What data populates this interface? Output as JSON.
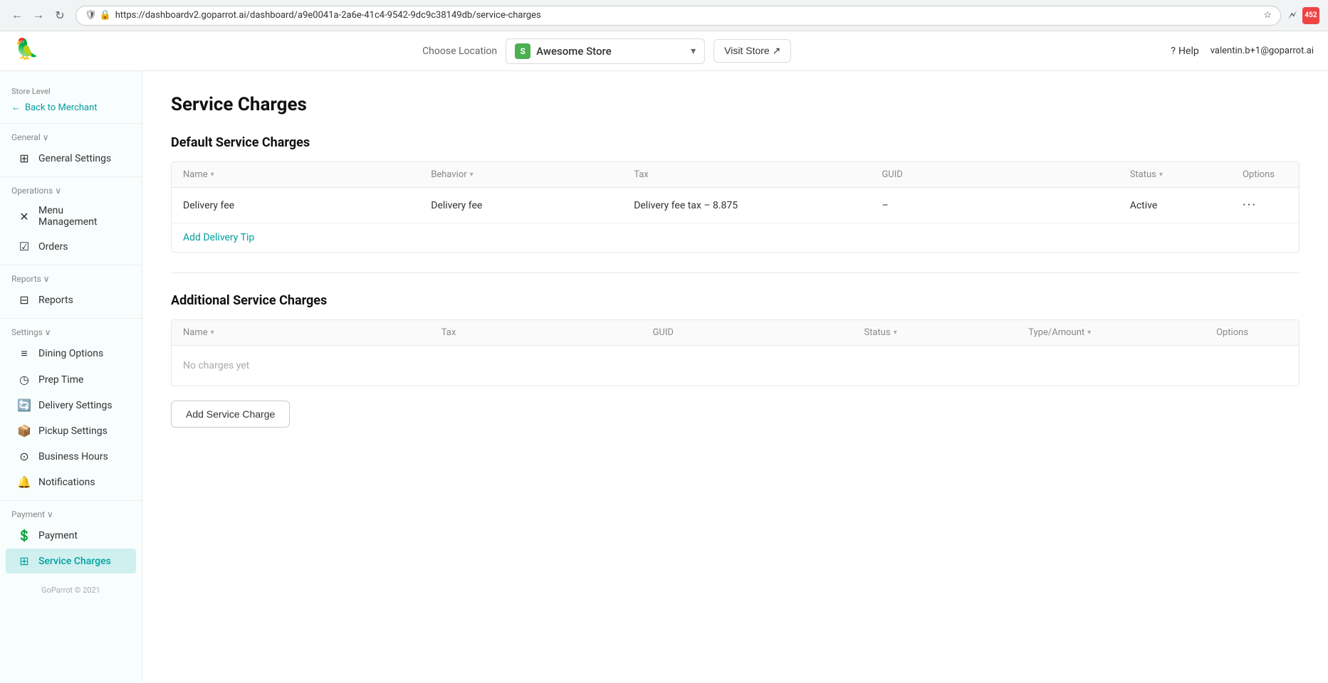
{
  "browser": {
    "url": "https://dashboardv2.goparrot.ai/dashboard/a9e0041a-2a6e-41c4-9542-9dc9c38149db/service-charges",
    "nav_back": "←",
    "nav_forward": "→",
    "nav_refresh": "↻",
    "ext_label": "452"
  },
  "header": {
    "logo_alt": "GoParrot logo",
    "choose_location_label": "Choose Location",
    "location_name": "Awesome Store",
    "location_initial": "S",
    "visit_store_label": "Visit Store ↗",
    "help_label": "Help",
    "user_email": "valentin.b+1@goparrot.ai"
  },
  "sidebar": {
    "store_level_label": "Store Level",
    "back_to_merchant": "Back to Merchant",
    "general_label": "General ∨",
    "general_settings": "General Settings",
    "operations_label": "Operations ∨",
    "menu_management": "Menu Management",
    "orders": "Orders",
    "reports_label": "Reports ∨",
    "reports": "Reports",
    "settings_label": "Settings ∨",
    "dining_options": "Dining Options",
    "prep_time": "Prep Time",
    "delivery_settings": "Delivery Settings",
    "pickup_settings": "Pickup Settings",
    "business_hours": "Business Hours",
    "notifications": "Notifications",
    "payment_label": "Payment ∨",
    "payment": "Payment",
    "service_charges": "Service Charges",
    "footer": "GoParrot © 2021"
  },
  "page": {
    "title": "Service Charges",
    "default_section_title": "Default Service Charges",
    "additional_section_title": "Additional Service Charges"
  },
  "default_table": {
    "columns": [
      {
        "key": "name",
        "label": "Name",
        "sortable": true
      },
      {
        "key": "behavior",
        "label": "Behavior",
        "sortable": true
      },
      {
        "key": "tax",
        "label": "Tax",
        "sortable": false
      },
      {
        "key": "guid",
        "label": "GUID",
        "sortable": false
      },
      {
        "key": "status",
        "label": "Status",
        "sortable": true
      },
      {
        "key": "options",
        "label": "Options",
        "sortable": false
      }
    ],
    "rows": [
      {
        "name": "Delivery fee",
        "behavior": "Delivery fee",
        "tax": "Delivery fee tax – 8.875",
        "guid": "–",
        "status": "Active",
        "options": "···"
      }
    ],
    "add_link": "Add Delivery Tip"
  },
  "additional_table": {
    "columns": [
      {
        "key": "name",
        "label": "Name",
        "sortable": true
      },
      {
        "key": "tax",
        "label": "Tax",
        "sortable": false
      },
      {
        "key": "guid",
        "label": "GUID",
        "sortable": false
      },
      {
        "key": "status",
        "label": "Status",
        "sortable": true
      },
      {
        "key": "typeamount",
        "label": "Type/Amount",
        "sortable": true
      },
      {
        "key": "options",
        "label": "Options",
        "sortable": false
      }
    ],
    "no_data_message": "No charges yet",
    "add_button_label": "Add Service Charge"
  }
}
